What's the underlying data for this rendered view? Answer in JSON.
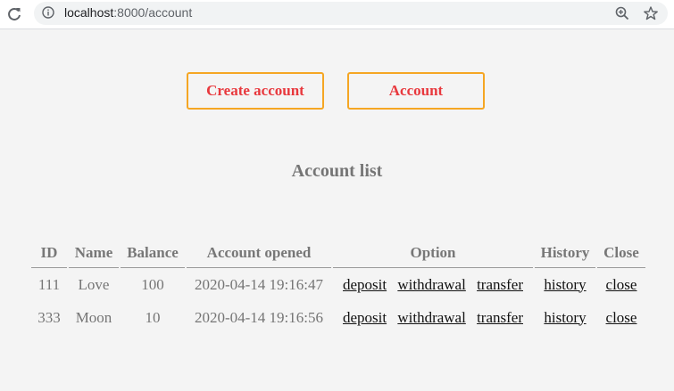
{
  "browser": {
    "url_host": "localhost",
    "url_path": ":8000/account"
  },
  "nav": {
    "create_label": "Create account",
    "account_label": "Account"
  },
  "title": "Account list",
  "table": {
    "headers": [
      "ID",
      "Name",
      "Balance",
      "Account opened",
      "Option",
      "History",
      "Close"
    ],
    "rows": [
      {
        "id": "111",
        "name": "Love",
        "balance": "100",
        "opened": "2020-04-14 19:16:47",
        "deposit": "deposit",
        "withdrawal": "withdrawal",
        "transfer": "transfer",
        "history": "history",
        "close": "close"
      },
      {
        "id": "333",
        "name": "Moon",
        "balance": "10",
        "opened": "2020-04-14 19:16:56",
        "deposit": "deposit",
        "withdrawal": "withdrawal",
        "transfer": "transfer",
        "history": "history",
        "close": "close"
      }
    ]
  },
  "colors": {
    "button_border": "#f5a623",
    "button_text": "#e8383d",
    "muted_text": "#757575",
    "background": "#f4f4f4"
  },
  "icons": [
    "reload-icon",
    "info-icon",
    "zoom-icon",
    "star-icon"
  ]
}
